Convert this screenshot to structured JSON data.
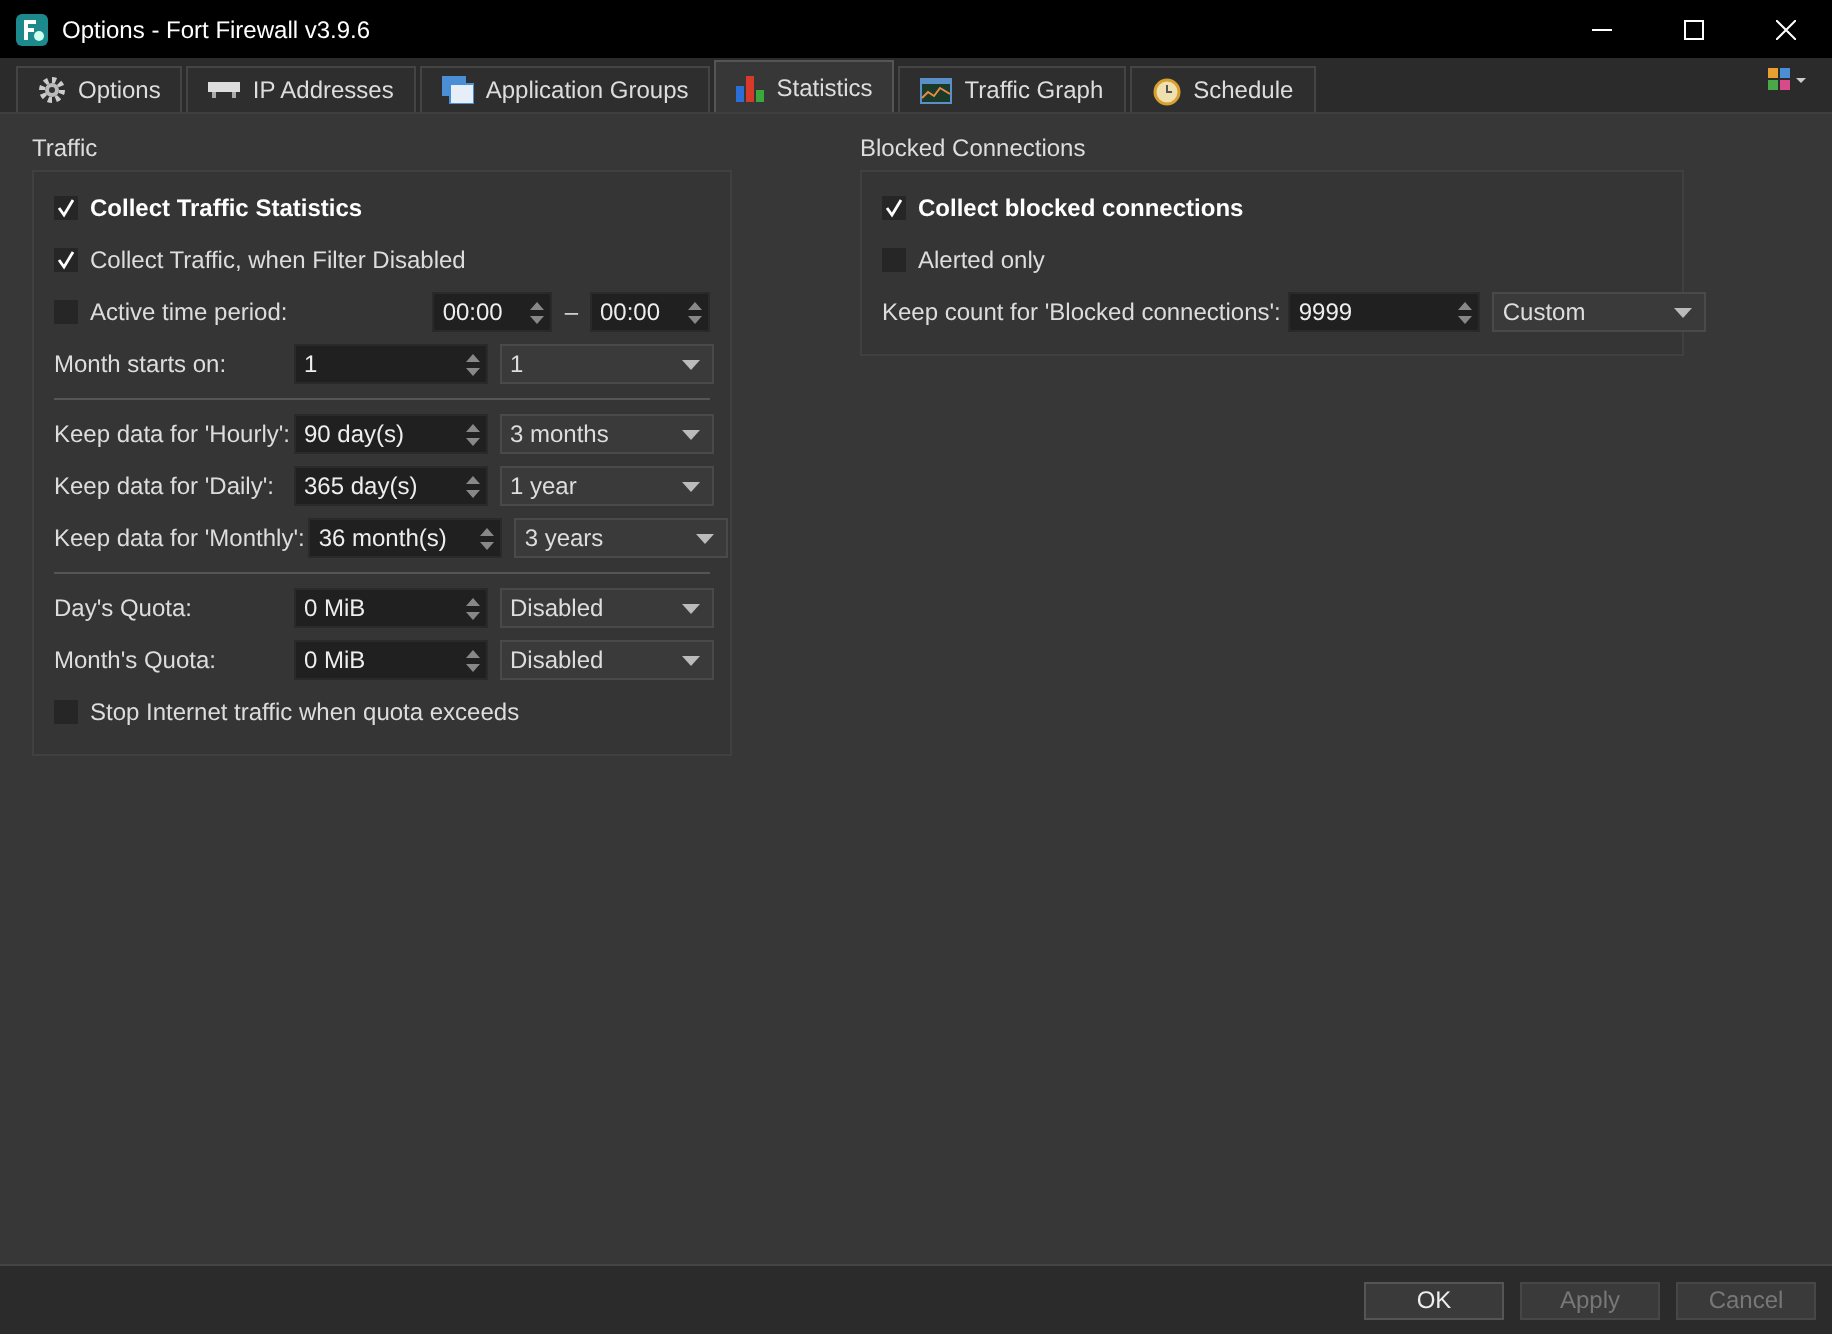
{
  "window": {
    "title": "Options - Fort Firewall v3.9.6"
  },
  "tabs": [
    {
      "label": "Options",
      "selected": false
    },
    {
      "label": "IP Addresses",
      "selected": false
    },
    {
      "label": "Application Groups",
      "selected": false
    },
    {
      "label": "Statistics",
      "selected": true
    },
    {
      "label": "Traffic Graph",
      "selected": false
    },
    {
      "label": "Schedule",
      "selected": false
    }
  ],
  "groups": [
    {
      "title": "Traffic",
      "rows": [
        {
          "kind": "main-checkbox",
          "label": "Collect Traffic Statistics",
          "checked": true
        },
        {
          "kind": "checkbox",
          "label": "Collect Traffic, when Filter Disabled",
          "checked": true
        },
        {
          "kind": "timerange",
          "label": "Active time period:",
          "checked": false,
          "from": "00:00",
          "separator": "–",
          "to": "00:00"
        },
        {
          "kind": "spin-combo",
          "label": "Month starts on:",
          "value": "1",
          "choice": "1"
        },
        {
          "kind": "separator"
        },
        {
          "kind": "spin-combo",
          "label": "Keep data for 'Hourly':",
          "value": "90 day(s)",
          "choice": "3 months"
        },
        {
          "kind": "spin-combo",
          "label": "Keep data for 'Daily':",
          "value": "365 day(s)",
          "choice": "1 year"
        },
        {
          "kind": "spin-combo",
          "label": "Keep data for 'Monthly':",
          "value": "36 month(s)",
          "choice": "3 years"
        },
        {
          "kind": "separator"
        },
        {
          "kind": "spin-combo",
          "label": "Day's Quota:",
          "value": "0 MiB",
          "choice": "Disabled"
        },
        {
          "kind": "spin-combo",
          "label": "Month's Quota:",
          "value": "0 MiB",
          "choice": "Disabled"
        },
        {
          "kind": "checkbox",
          "label": "Stop Internet traffic when quota exceeds",
          "checked": false
        }
      ]
    },
    {
      "title": "Blocked Connections",
      "rows": [
        {
          "kind": "main-checkbox",
          "label": "Collect blocked connections",
          "checked": true
        },
        {
          "kind": "checkbox",
          "label": "Alerted only",
          "checked": false
        },
        {
          "kind": "spin-combo",
          "label": "Keep count for 'Blocked connections':",
          "value": "9999",
          "choice": "Custom"
        }
      ]
    }
  ],
  "buttons": [
    {
      "label": "OK",
      "disabled": false
    },
    {
      "label": "Apply",
      "disabled": true
    },
    {
      "label": "Cancel",
      "disabled": true
    }
  ]
}
